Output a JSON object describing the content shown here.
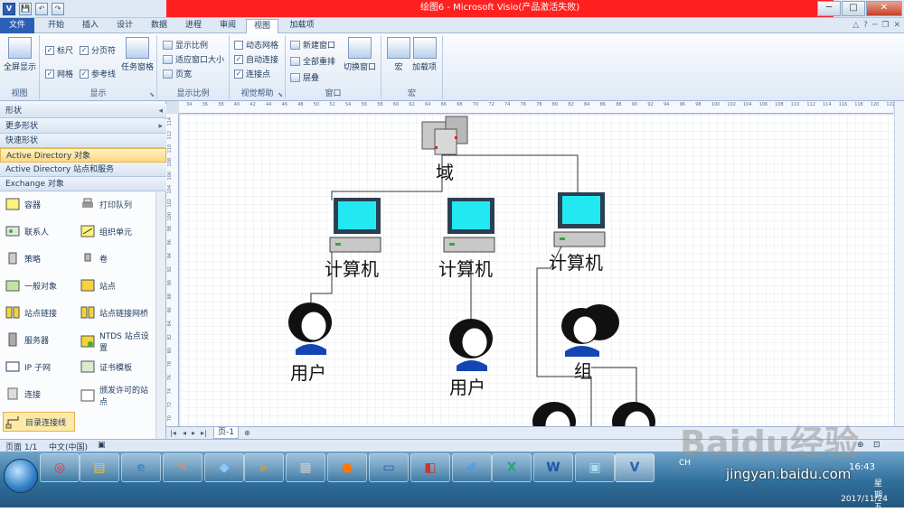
{
  "window": {
    "title": "绘图6 - Microsoft Visio(产品激活失败)",
    "buttons": [
      "─",
      "□",
      "✕"
    ]
  },
  "qat": [
    "V",
    "💾",
    "↶",
    "↷"
  ],
  "tabs": [
    {
      "label": "文件"
    },
    {
      "label": "开始"
    },
    {
      "label": "插入"
    },
    {
      "label": "设计"
    },
    {
      "label": "数据"
    },
    {
      "label": "进程"
    },
    {
      "label": "审阅"
    },
    {
      "label": "视图"
    },
    {
      "label": "加载项"
    }
  ],
  "ribbon": {
    "view": {
      "fullscreen": "全屏显示",
      "label": "视图"
    },
    "show": {
      "ruler": "标尺",
      "pagebreak": "分页符",
      "grid": "网格",
      "guides": "参考线",
      "taskpane": "任务窗格",
      "label": "显示"
    },
    "zoom": {
      "zoom": "显示比例",
      "fit": "适应窗口大小",
      "pagewidth": "页宽",
      "label": "显示比例"
    },
    "visual": {
      "dynamicgrid": "动态网格",
      "autoconnect": "自动连接",
      "connpoints": "连接点",
      "label": "视觉帮助"
    },
    "window": {
      "newwin": "新建窗口",
      "arrange": "全部重排",
      "cascade": "层叠",
      "switch": "切换窗口",
      "label": "窗口"
    },
    "macros": {
      "macro": "宏",
      "addins": "加载项",
      "label": "宏"
    }
  },
  "shapes_panel": {
    "header": "形状",
    "more": "更多形状",
    "quick": "快速形状",
    "stencils": [
      "Active Directory 对象",
      "Active Directory 站点和服务",
      "Exchange 对象"
    ],
    "items": [
      {
        "label": "容器"
      },
      {
        "label": "打印队列"
      },
      {
        "label": "联系人"
      },
      {
        "label": "组织单元"
      },
      {
        "label": "策略"
      },
      {
        "label": "卷"
      },
      {
        "label": "一般对象"
      },
      {
        "label": "站点"
      },
      {
        "label": "站点链接"
      },
      {
        "label": "站点链接网桥"
      },
      {
        "label": "服务器"
      },
      {
        "label": "NTDS 站点设置"
      },
      {
        "label": "IP 子网"
      },
      {
        "label": "证书模板"
      },
      {
        "label": "连接"
      },
      {
        "label": "颁发许可的站点"
      },
      {
        "label": "目录连接线"
      }
    ]
  },
  "ruler": {
    "h": [
      "34",
      "36",
      "38",
      "40",
      "42",
      "44",
      "46",
      "48",
      "50",
      "52",
      "54",
      "56",
      "58",
      "60",
      "62",
      "64",
      "66",
      "68",
      "70",
      "72",
      "74",
      "76",
      "78",
      "80",
      "82",
      "84",
      "86",
      "88",
      "90",
      "92",
      "94",
      "96",
      "98",
      "100",
      "102",
      "104",
      "106",
      "108",
      "110",
      "112",
      "114",
      "116",
      "118",
      "120",
      "122"
    ],
    "v": [
      "114",
      "112",
      "110",
      "108",
      "106",
      "104",
      "102",
      "100",
      "98",
      "96",
      "94",
      "92",
      "90",
      "88",
      "86",
      "84",
      "82",
      "80",
      "78",
      "76",
      "74",
      "72",
      "70"
    ]
  },
  "diagram": {
    "domain": "域",
    "computers": [
      "计算机",
      "计算机",
      "计算机"
    ],
    "users": [
      "用户",
      "用户"
    ],
    "group": "组"
  },
  "pagebar": {
    "page": "页-1"
  },
  "status": {
    "pages": "页面 1/1",
    "lang": "中文(中国)"
  },
  "taskbar": {
    "time": "16:43",
    "weekday": "星期五",
    "date": "2017/11/24",
    "ime": "CH"
  },
  "watermark": {
    "brand": "Baidu经验",
    "url": "jingyan.baidu.com"
  }
}
